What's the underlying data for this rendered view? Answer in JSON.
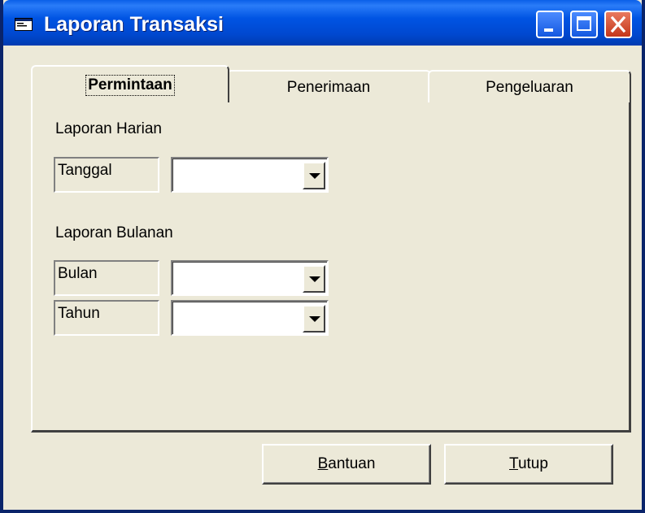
{
  "window": {
    "title": "Laporan Transaksi",
    "title_bar_color": "#0054e3",
    "background_color": "#ece9d8"
  },
  "title_buttons": {
    "minimize_icon": "minimize-icon",
    "maximize_icon": "maximize-icon",
    "close_icon": "close-icon"
  },
  "tabs": [
    {
      "label": "Permintaan",
      "active": true
    },
    {
      "label": "Penerimaan",
      "active": false
    },
    {
      "label": "Pengeluaran",
      "active": false
    }
  ],
  "daily": {
    "heading": "Laporan Harian",
    "tanggal_label": "Tanggal",
    "tanggal_value": ""
  },
  "monthly": {
    "heading": "Laporan Bulanan",
    "bulan_label": "Bulan",
    "bulan_value": "",
    "tahun_label": "Tahun",
    "tahun_value": ""
  },
  "buttons": {
    "bantuan": {
      "mnemonic": "B",
      "rest": "antuan"
    },
    "tutup": {
      "mnemonic": "T",
      "rest": "utup"
    }
  }
}
